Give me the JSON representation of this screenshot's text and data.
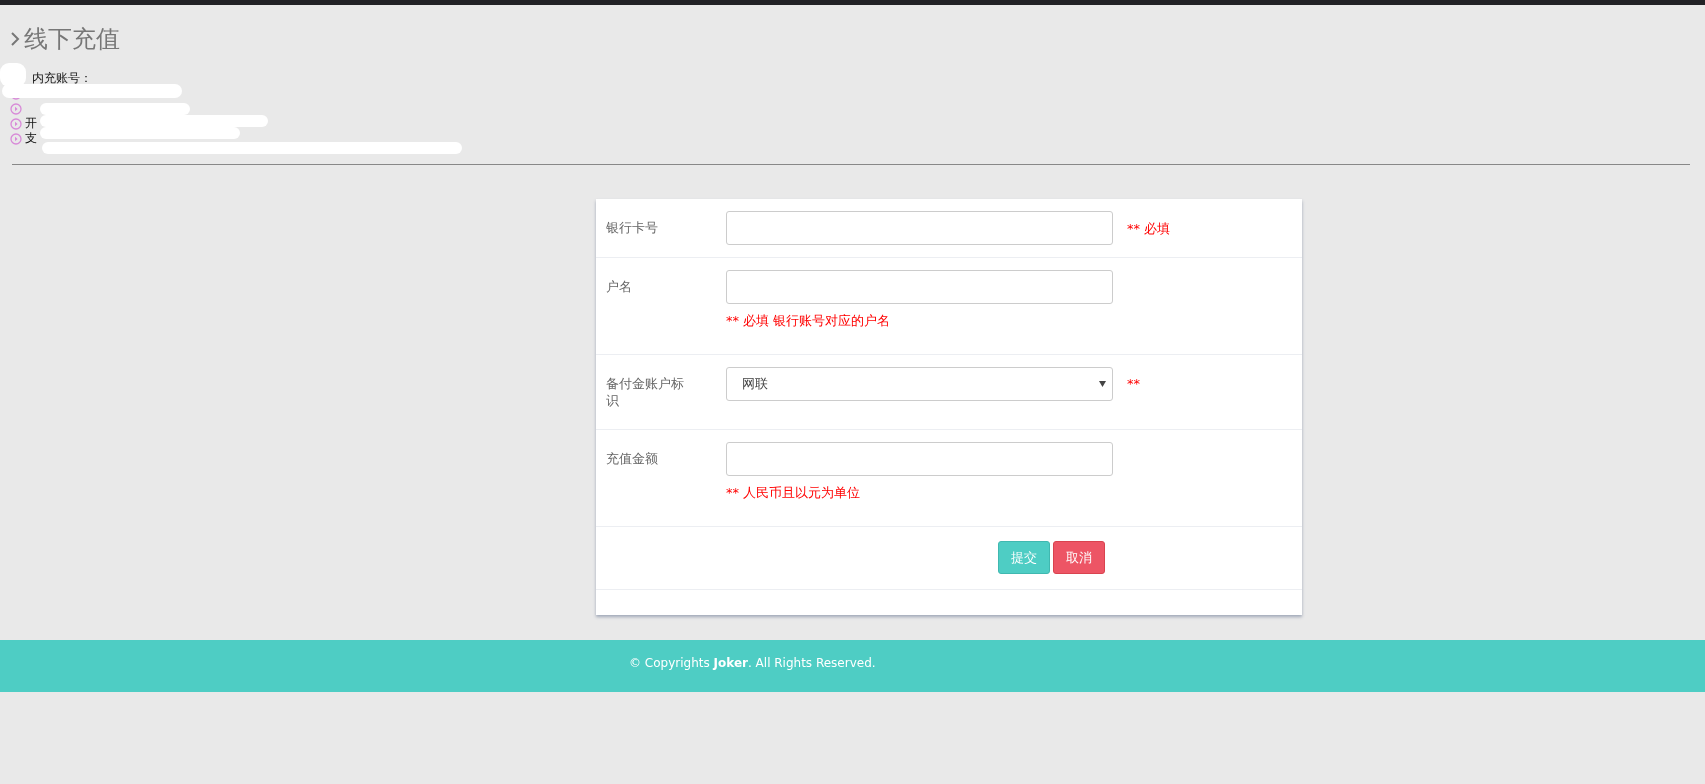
{
  "page_title": "线下充值",
  "account_info": {
    "label": "内充账号：",
    "items": [
      {
        "kind": "hidden"
      },
      {
        "kind": "hidden"
      },
      {
        "kind": "text",
        "text": "开"
      },
      {
        "kind": "text",
        "text": "支"
      }
    ]
  },
  "form": {
    "rows": [
      {
        "kind": "input",
        "label": "银行卡号",
        "hint": {
          "kind": "side",
          "text": "** 必填"
        }
      },
      {
        "kind": "input",
        "label": "户名",
        "hint": {
          "kind": "below",
          "text": "** 必填 银行账号对应的户名"
        }
      },
      {
        "kind": "select",
        "label": "备付金账户标识",
        "value": "网联",
        "hint": {
          "kind": "side",
          "text": "**"
        }
      },
      {
        "kind": "input",
        "label": "充值金额",
        "hint": {
          "kind": "below",
          "text": "** 人民币且以元为单位"
        }
      }
    ],
    "buttons": [
      {
        "label": "提交",
        "kind": "primary"
      },
      {
        "label": "取消",
        "kind": "danger"
      }
    ]
  },
  "footer": {
    "text": "© Copyrights **Joker**. All Rights Reserved."
  }
}
